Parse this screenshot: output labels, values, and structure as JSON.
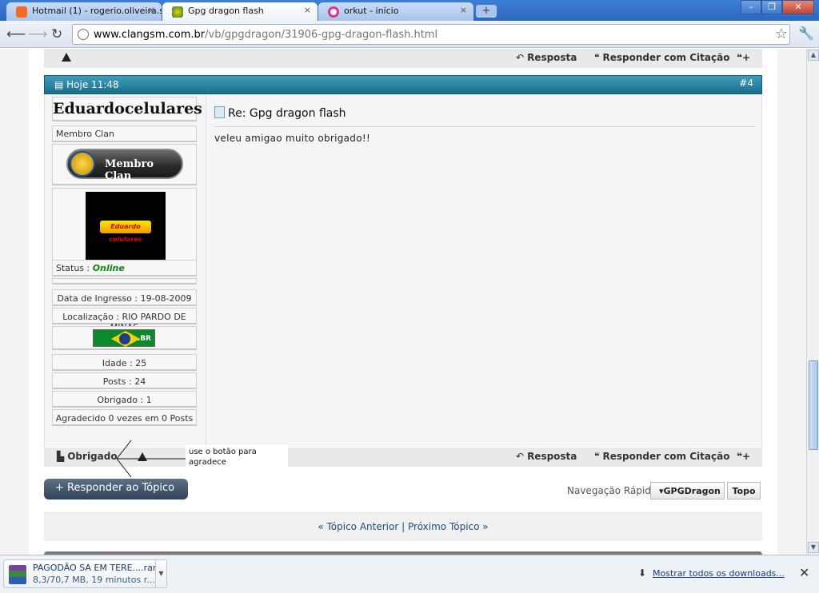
{
  "browser": {
    "tabs": [
      {
        "title": "Hotmail (1) - rogerio.oliveira.s",
        "active": false,
        "favicon_color": "#f26b21"
      },
      {
        "title": "Gpg dragon flash",
        "active": true,
        "favicon_color": "#2a7a3a"
      },
      {
        "title": "orkut - início",
        "active": false,
        "favicon_color": "#e0348c"
      }
    ],
    "tab_close": "×",
    "new_tab": "+",
    "window_buttons": {
      "minimize": "–",
      "restore": "❐",
      "close": "✕"
    },
    "url_host": "www.clangsm.com.br",
    "url_path": "/vb/gpgdragon/31906-gpg-dragon-flash.html"
  },
  "post_actions": {
    "reply": "Resposta",
    "reply_quote": "Responder com Citação",
    "thanks": "Obrigado"
  },
  "post": {
    "date": "Hoje 11:48",
    "number": "#4",
    "title": "Re: Gpg dragon flash",
    "body": "veleu amigao muito obrigado!!"
  },
  "user": {
    "name": "Eduardocelulares",
    "title": "Membro Clan",
    "rank_badge": "Membro Clan",
    "avatar_text": "Eduardo celulares",
    "status_label": "Status :",
    "status_value": "Online",
    "join_date": "Data de Ingresso : 19-08-2009",
    "location": "Localização : RIO PARDO DE MINAS",
    "flag_label": ".BR",
    "age": "Idade : 25",
    "posts": "Posts : 24",
    "thanked": "Obrigado : 1",
    "thanked_received": "Agradecido 0 vezes em 0 Posts"
  },
  "annotation": "use o botão para agradece",
  "footer": {
    "reply_topic": "Responder ao Tópico",
    "quick_nav_label": "Navegação Rápida",
    "quick_nav_value": "GPGDragon",
    "top": "Topo",
    "prev_topic": "« Tópico Anterior",
    "separator": "|",
    "next_topic": "Próximo Tópico »"
  },
  "download_shelf": {
    "file_name": "PAGODÃO SA EM TERE....rar",
    "file_status": "8,3/70,7 MB, 19 minutos r...",
    "show_all": "Mostrar todos os downloads...",
    "close": "✕"
  },
  "colors": {
    "post_header": "#1c6f8d",
    "status_online": "#0a8a0a",
    "link": "#1f4e7a"
  }
}
